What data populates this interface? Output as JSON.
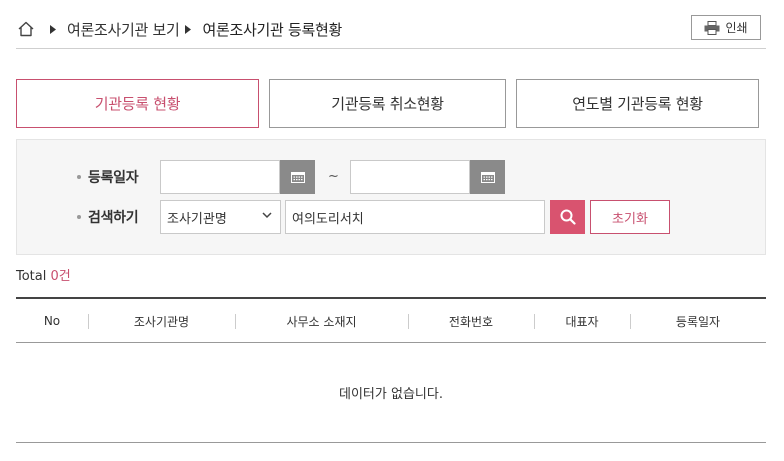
{
  "breadcrumb": {
    "home_icon": "home-icon",
    "items": [
      "여론조사기관 보기",
      "여론조사기관 등록현황"
    ]
  },
  "print_button": {
    "label": "인쇄",
    "icon": "printer-icon"
  },
  "tabs": [
    {
      "label": "기관등록 현황",
      "active": true
    },
    {
      "label": "기관등록 취소현황",
      "active": false
    },
    {
      "label": "연도별 기관등록 현황",
      "active": false
    }
  ],
  "search": {
    "date_label": "등록일자",
    "date_from": "",
    "date_to": "",
    "date_separator": "~",
    "keyword_label": "검색하기",
    "select_value": "조사기관명",
    "keyword_value": "여의도리서치",
    "reset_label": "초기화"
  },
  "total": {
    "prefix": "Total",
    "count": "0건"
  },
  "table": {
    "columns": [
      "No",
      "조사기관명",
      "사무소 소재지",
      "전화번호",
      "대표자",
      "등록일자"
    ],
    "empty_message": "데이터가 없습니다."
  },
  "colors": {
    "accent": "#c8506f",
    "search_button": "#d9536f",
    "calendar_button": "#8a8a8a"
  }
}
